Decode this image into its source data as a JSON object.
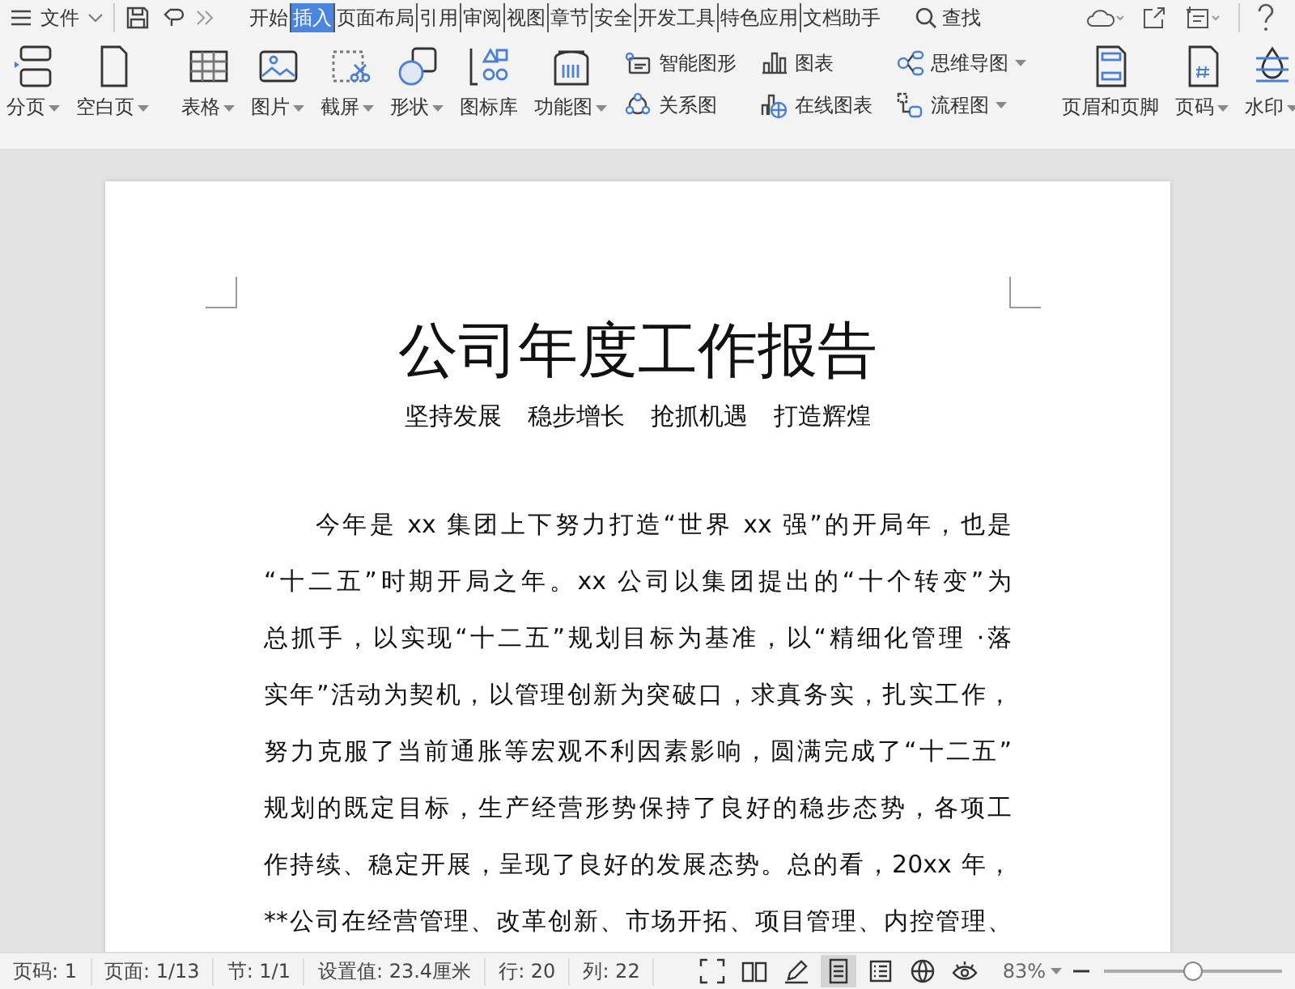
{
  "menu_bar": {
    "file_menu": "文件",
    "tabs": [
      {
        "label": "开始",
        "selected": false
      },
      {
        "label": "插入",
        "selected": true
      },
      {
        "label": "页面布局",
        "selected": false
      },
      {
        "label": "引用",
        "selected": false
      },
      {
        "label": "审阅",
        "selected": false
      },
      {
        "label": "视图",
        "selected": false
      },
      {
        "label": "章节",
        "selected": false
      },
      {
        "label": "安全",
        "selected": false
      },
      {
        "label": "开发工具",
        "selected": false
      },
      {
        "label": "特色应用",
        "selected": false
      },
      {
        "label": "文档助手",
        "selected": false
      }
    ],
    "search": "查找"
  },
  "ribbon": {
    "groups": [
      {
        "kind": "large",
        "items": [
          {
            "label": "分页",
            "dropdown": true
          },
          {
            "label": "空白页",
            "dropdown": true
          }
        ]
      },
      {
        "kind": "large",
        "items": [
          {
            "label": "表格",
            "dropdown": true
          },
          {
            "label": "图片",
            "dropdown": true
          },
          {
            "label": "截屏",
            "dropdown": true
          },
          {
            "label": "形状",
            "dropdown": true
          },
          {
            "label": "图标库",
            "dropdown": false
          },
          {
            "label": "功能图",
            "dropdown": true
          }
        ]
      },
      {
        "kind": "small",
        "items": [
          {
            "label": "智能图形",
            "dropdown": false
          },
          {
            "label": "关系图",
            "dropdown": false
          },
          {
            "label": "图表",
            "dropdown": false
          },
          {
            "label": "在线图表",
            "dropdown": false
          },
          {
            "label": "思维导图",
            "dropdown": true
          },
          {
            "label": "流程图",
            "dropdown": true
          }
        ]
      },
      {
        "kind": "large",
        "items": [
          {
            "label": "页眉和页脚",
            "dropdown": false
          },
          {
            "label": "页码",
            "dropdown": true
          },
          {
            "label": "水印",
            "dropdown": true
          }
        ]
      }
    ]
  },
  "document": {
    "title": "公司年度工作报告",
    "subtitle": [
      "坚持发展",
      "稳步增长",
      "抢抓机遇",
      "打造辉煌"
    ],
    "lines": [
      "今年是 xx 集团上下努力打造“世界 xx 强”的开局年，也是",
      "“十二五”时期开局之年。xx 公司以集团提出的“十个转变”为",
      "总抓手，以实现“十二五”规划目标为基准，以“精细化管理 ·落",
      "实年”活动为契机，以管理创新为突破口，求真务实，扎实工作，",
      "努力克服了当前通胀等宏观不利因素影响，圆满完成了“十二五”",
      "规划的既定目标，生产经营形势保持了良好的稳步态势，各项工",
      "作持续、稳定开展，呈现了良好的发展态势。总的看，20xx 年，",
      "**公司在经营管理、改革创新、市场开拓、项目管理、内控管理、"
    ]
  },
  "status_bar": {
    "fields": [
      "页码: 1",
      "页面: 1/13",
      "节: 1/1",
      "设置值: 23.4厘米",
      "行: 20",
      "列: 22"
    ],
    "views": [
      {
        "selected": false
      },
      {
        "selected": false
      },
      {
        "selected": false
      },
      {
        "selected": true
      },
      {
        "selected": false
      },
      {
        "selected": false
      },
      {
        "selected": false
      }
    ],
    "zoom": "83%",
    "zoom_slider": {
      "level": 0.5
    }
  }
}
